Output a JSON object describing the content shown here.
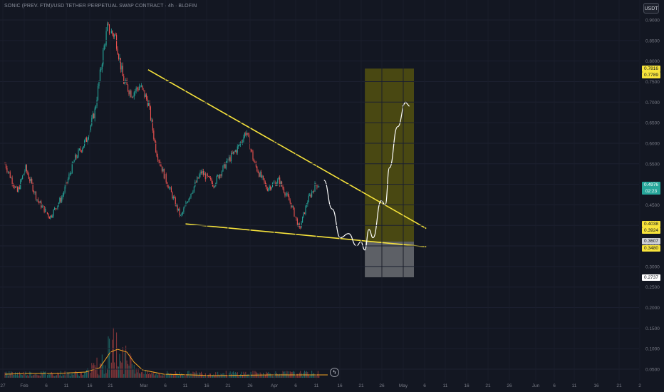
{
  "header": {
    "title": "SONIC (PREV. FTM)/USD TETHER PERPETUAL SWAP CONTRACT · 4h · BLOFIN",
    "unit": "USDT"
  },
  "colors": {
    "background": "#131722",
    "up": "#26a69a",
    "down": "#ef5350",
    "trendline": "#f7e33b",
    "target_zone": "#5c5a0e",
    "stop_zone": "#6b6d72",
    "projection": "#ffffff",
    "volume_ma": "#f6a623"
  },
  "icons": {
    "lightning": "lightning-icon"
  },
  "price_labels": [
    {
      "text": "0.7816",
      "value": 0.7816,
      "bg": "#f7e33b",
      "fg": "#131722"
    },
    {
      "text": "0.7789",
      "value": 0.7789,
      "bg": "#f7e33b",
      "fg": "#131722"
    },
    {
      "text": "0.4976",
      "value": 0.4976,
      "bg": "#26a69a",
      "fg": "#ffffff",
      "sub": "02:23"
    },
    {
      "text": "0.4038",
      "value": 0.4038,
      "bg": "#f7e33b",
      "fg": "#131722"
    },
    {
      "text": "0.3924",
      "value": 0.3924,
      "bg": "#f7e33b",
      "fg": "#131722"
    },
    {
      "text": "0.3607",
      "value": 0.3607,
      "bg": "#cfd1d6",
      "fg": "#131722"
    },
    {
      "text": "0.3480",
      "value": 0.348,
      "bg": "#f7e33b",
      "fg": "#131722"
    },
    {
      "text": "0.2737",
      "value": 0.2737,
      "bg": "#ffffff",
      "fg": "#131722"
    }
  ],
  "chart_data": {
    "type": "candlestick",
    "timeframe": "4h",
    "y_ticks": [
      "0.9000",
      "0.8500",
      "0.8000",
      "0.7500",
      "0.7000",
      "0.6500",
      "0.6000",
      "0.5500",
      "0.5000",
      "0.4500",
      "0.4000",
      "0.3500",
      "0.3000",
      "0.2500",
      "0.2000",
      "0.1500",
      "0.1000",
      "0.0500"
    ],
    "x_ticks": [
      "27",
      "Feb",
      "6",
      "11",
      "16",
      "21",
      "Mar",
      "6",
      "11",
      "16",
      "21",
      "26",
      "Apr",
      "6",
      "11",
      "16",
      "21",
      "26",
      "May",
      "6",
      "11",
      "16",
      "21",
      "26",
      "Jun",
      "6",
      "11",
      "16",
      "21",
      "2"
    ],
    "last_price": 0.4976,
    "countdown": "02:23",
    "price_path": [
      [
        "Jan 27",
        0.55
      ],
      [
        "Jan 30",
        0.48
      ],
      [
        "Feb 1",
        0.54
      ],
      [
        "Feb 4",
        0.46
      ],
      [
        "Feb 7",
        0.42
      ],
      [
        "Feb 10",
        0.47
      ],
      [
        "Feb 13",
        0.56
      ],
      [
        "Feb 16",
        0.61
      ],
      [
        "Feb 18",
        0.68
      ],
      [
        "Feb 20",
        0.82
      ],
      [
        "Feb 21",
        0.88
      ],
      [
        "Feb 23",
        0.86
      ],
      [
        "Feb 25",
        0.75
      ],
      [
        "Feb 27",
        0.72
      ],
      [
        "Mar 1",
        0.74
      ],
      [
        "Mar 3",
        0.7
      ],
      [
        "Mar 5",
        0.58
      ],
      [
        "Mar 7",
        0.52
      ],
      [
        "Mar 9",
        0.47
      ],
      [
        "Mar 11",
        0.42
      ],
      [
        "Mar 13",
        0.47
      ],
      [
        "Mar 16",
        0.53
      ],
      [
        "Mar 19",
        0.5
      ],
      [
        "Mar 22",
        0.55
      ],
      [
        "Mar 25",
        0.59
      ],
      [
        "Mar 27",
        0.63
      ],
      [
        "Mar 29",
        0.55
      ],
      [
        "Apr 1",
        0.49
      ],
      [
        "Apr 4",
        0.51
      ],
      [
        "Apr 7",
        0.45
      ],
      [
        "Apr 9",
        0.39
      ],
      [
        "Apr 11",
        0.46
      ],
      [
        "Apr 13",
        0.5
      ],
      [
        "Apr 14",
        0.4976
      ]
    ],
    "trendlines": [
      {
        "name": "upper",
        "from": [
          "Mar 3",
          0.7789
        ],
        "to": [
          "May 10",
          0.3924
        ]
      },
      {
        "name": "lower",
        "from": [
          "Mar 12",
          0.4038
        ],
        "to": [
          "May 10",
          0.348
        ]
      }
    ],
    "zones": [
      {
        "name": "target",
        "from": "Apr 25",
        "to": "May 7",
        "top": 0.7816,
        "bottom": 0.3607
      },
      {
        "name": "stop",
        "from": "Apr 25",
        "to": "May 7",
        "top": 0.3607,
        "bottom": 0.2737
      }
    ],
    "projection": [
      [
        "Apr 15",
        0.51
      ],
      [
        "Apr 17",
        0.44
      ],
      [
        "Apr 19",
        0.37
      ],
      [
        "Apr 21",
        0.38
      ],
      [
        "Apr 23",
        0.35
      ],
      [
        "Apr 24",
        0.36
      ],
      [
        "Apr 25",
        0.34
      ],
      [
        "Apr 26",
        0.39
      ],
      [
        "Apr 27",
        0.37
      ],
      [
        "Apr 29",
        0.46
      ],
      [
        "Apr 30",
        0.45
      ],
      [
        "May 1",
        0.54
      ],
      [
        "May 3",
        0.64
      ],
      [
        "May 5",
        0.7
      ]
    ],
    "grid": true
  }
}
